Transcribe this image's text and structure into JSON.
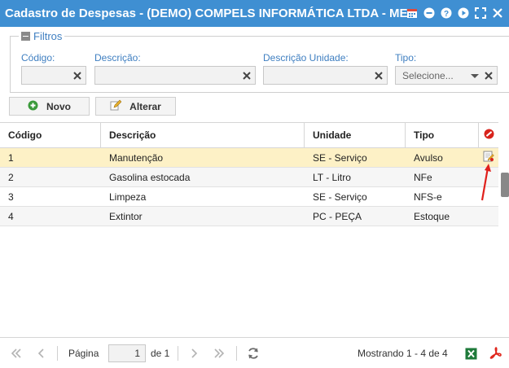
{
  "window": {
    "title": "Cadastro de Despesas - (DEMO) COMPELS INFORMÁTICA LTDA - ME ...",
    "icons": [
      "calendar-icon",
      "minimize-icon",
      "help-icon",
      "play-icon",
      "fullscreen-icon",
      "close-icon"
    ]
  },
  "filters": {
    "legend": "Filtros",
    "codigo": {
      "label": "Código:",
      "value": ""
    },
    "descricao": {
      "label": "Descrição:",
      "value": ""
    },
    "descricao_unidade": {
      "label": "Descrição Unidade:",
      "value": ""
    },
    "tipo": {
      "label": "Tipo:",
      "value": "Selecione..."
    }
  },
  "toolbar": {
    "novo_label": "Novo",
    "alterar_label": "Alterar"
  },
  "table": {
    "columns": [
      "Código",
      "Descrição",
      "Unidade",
      "Tipo"
    ],
    "rows": [
      {
        "codigo": "1",
        "descricao": "Manutenção",
        "unidade": "SE - Serviço",
        "tipo": "Avulso"
      },
      {
        "codigo": "2",
        "descricao": "Gasolina estocada",
        "unidade": "LT - Litro",
        "tipo": "NFe"
      },
      {
        "codigo": "3",
        "descricao": "Limpeza",
        "unidade": "SE - Serviço",
        "tipo": "NFS-e"
      },
      {
        "codigo": "4",
        "descricao": "Extintor",
        "unidade": "PC - PEÇA",
        "tipo": "Estoque"
      }
    ]
  },
  "pager": {
    "page_label": "Página",
    "page_value": "1",
    "of_label": "de 1",
    "showing": "Mostrando 1 - 4 de 4"
  },
  "colors": {
    "titlebar": "#3f8fd2",
    "selected_row": "#fdf1c6",
    "accent_text": "#3f7fc1",
    "annotation_arrow": "#e0201c"
  }
}
